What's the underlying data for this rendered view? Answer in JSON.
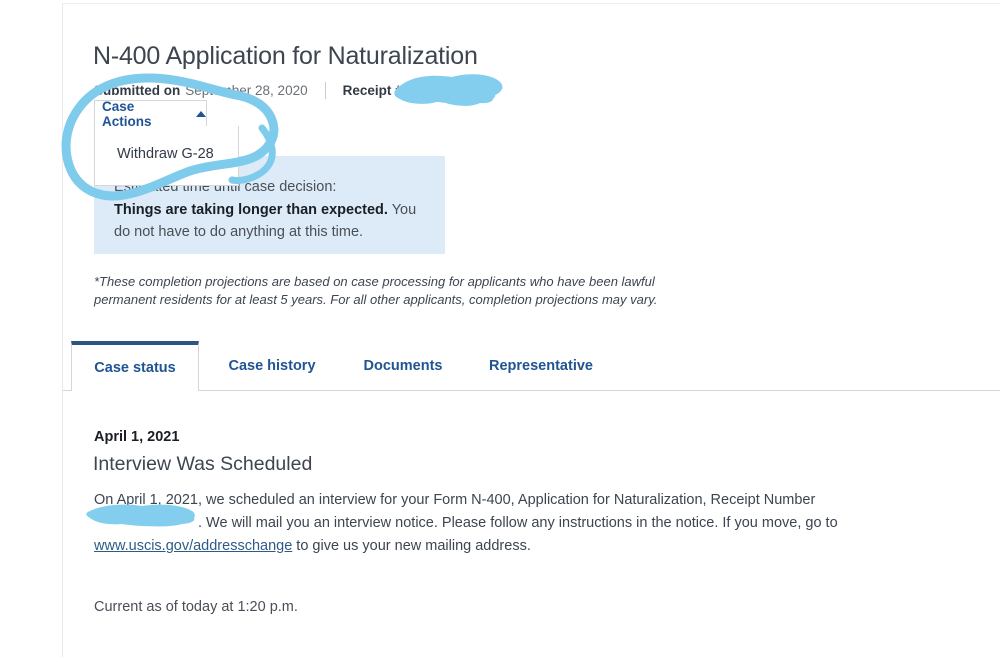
{
  "header": {
    "title": "N-400 Application for Naturalization",
    "submitted_label": "Submitted on",
    "submitted_date": "September 28, 2020",
    "receipt_label": "Receipt #",
    "receipt_value_redacted": ""
  },
  "case_actions": {
    "button_label": "Case Actions",
    "caret_icon": "caret-up-icon",
    "expanded": true,
    "menu_items": [
      {
        "label": "Withdraw G-28"
      }
    ]
  },
  "info_box": {
    "line1": "Estimated time until case decision:",
    "line2_bold": "Things are taking longer than expected.",
    "line2_rest": " You do not have to do anything at this time.",
    "background": "#dcebf7"
  },
  "disclaimer": "*These completion projections are based on case processing for applicants who have been lawful permanent residents for at least 5 years. For all other applicants, completion projections may vary.",
  "tabs": {
    "active_index": 0,
    "items": [
      {
        "label": "Case status"
      },
      {
        "label": "Case history"
      },
      {
        "label": "Documents"
      },
      {
        "label": "Representative"
      }
    ]
  },
  "case_status": {
    "event_date": "April 1, 2021",
    "event_title": "Interview Was Scheduled",
    "body_part1": "On April 1, 2021, we scheduled an interview for your Form N-400, Application for Naturalization, Receipt Number ",
    "body_redacted": "",
    "body_part2": ". We will mail you an interview notice. Please follow any instructions in the notice. If you move, go to ",
    "link_text": "www.uscis.gov/addresschange",
    "body_part3": " to give us your new mailing address.",
    "current_as_of": "Current as of today at 1:20 p.m."
  },
  "annotations": {
    "circle_color": "#7fcbec",
    "redaction_color": "#83cdee",
    "circle_name": "hand-drawn-circle-highlight",
    "redaction_receipt_name": "redaction-mark-receipt-number",
    "redaction_body_name": "redaction-mark-body-receipt-number"
  },
  "colors": {
    "link": "#205493",
    "active_tab_border": "#2e5481",
    "title_text": "#3d4551",
    "info_box_bg": "#dcebf7"
  }
}
